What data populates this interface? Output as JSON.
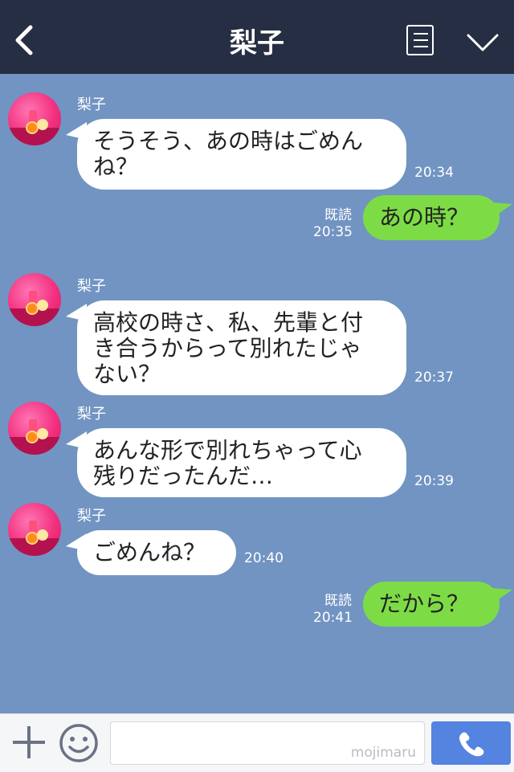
{
  "header": {
    "title": "梨子",
    "back_icon": "chevron-left-icon",
    "menu_icon": "list-menu-icon",
    "expand_icon": "chevron-down-icon"
  },
  "messages": [
    {
      "dir": "in",
      "sender": "梨子",
      "lines": [
        "そうそう、あの時はごめん",
        "ね？"
      ],
      "time": "20:34"
    },
    {
      "dir": "out",
      "read": "既読",
      "lines": [
        "あの時？"
      ],
      "time": "20:35"
    },
    {
      "dir": "in",
      "sender": "梨子",
      "lines": [
        "高校の時さ、私、先輩と付",
        "き合うからって別れたじゃ",
        "ない？"
      ],
      "time": "20:37"
    },
    {
      "dir": "in",
      "sender": "梨子",
      "lines": [
        "あんな形で別れちゃって心",
        "残りだったんだ…"
      ],
      "time": "20:39"
    },
    {
      "dir": "in",
      "sender": "梨子",
      "lines": [
        "ごめんね？"
      ],
      "time": "20:40"
    },
    {
      "dir": "out",
      "read": "既読",
      "lines": [
        "だから？"
      ],
      "time": "20:41"
    }
  ],
  "input_bar": {
    "plus_icon": "plus-icon",
    "emoji_icon": "smiley-icon",
    "placeholder": "",
    "watermark": "mojimaru",
    "call_icon": "phone-icon"
  },
  "colors": {
    "header_bg": "#262e43",
    "chat_bg": "#7194c2",
    "incoming_bubble": "#ffffff",
    "outgoing_bubble": "#7ddc46",
    "call_button": "#5583e0"
  }
}
